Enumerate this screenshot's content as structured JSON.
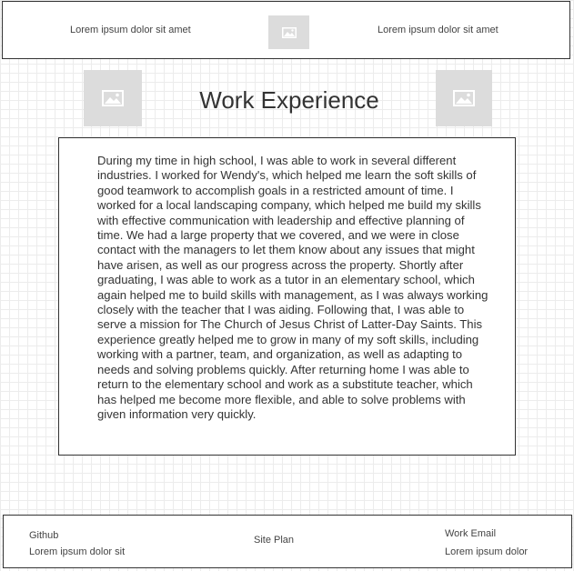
{
  "header": {
    "left_link": "Lorem ipsum dolor sit amet",
    "right_link": "Lorem ipsum dolor sit amet",
    "logo_icon": "image-icon"
  },
  "main": {
    "title": "Work Experience",
    "left_image_icon": "image-icon",
    "right_image_icon": "image-icon",
    "body": "During my time in high school, I was able to work in several different industries. I worked for Wendy's, which helped me learn the soft skills of good teamwork to accomplish goals in a restricted amount of time. I worked for a local landscaping company, which helped me build my skills with effective communication with leadership and effective planning of time. We had a large property that we covered, and we were in close contact with the managers to let them know about any issues that might have arisen, as well as our progress across the property. Shortly after graduating, I was able to work as a tutor in an elementary school, which again helped me to build skills with management, as I was always working closely with the teacher that I was aiding. Following that, I was able to serve a mission for The Church of Jesus Christ of Latter-Day Saints. This experience greatly helped me to grow in many of my soft skills, including working with a partner, team, and organization, as well as adapting to needs and solving problems quickly. After returning home I was able to return to the elementary school and work as a substitute teacher, which has helped me become more flexible, and able to solve problems with given information very quickly."
  },
  "footer": {
    "github_label": "Github",
    "github_sub": "Lorem ipsum dolor sit",
    "site_plan": "Site Plan",
    "email_label": "Work Email",
    "email_sub": "Lorem ipsum dolor"
  },
  "colors": {
    "placeholder": "#dcdcdc",
    "border": "#333333",
    "grid": "#ececec"
  }
}
